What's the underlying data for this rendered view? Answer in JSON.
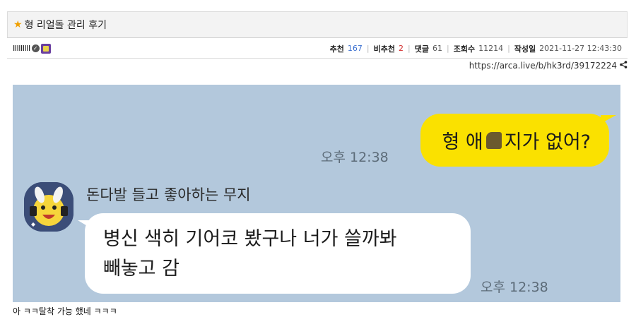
{
  "post": {
    "title_star": "★",
    "title": "형 리얼돌 관리 후기",
    "author": "IIIIIIIII",
    "stats": {
      "recommend_label": "추천",
      "recommend_value": "167",
      "unrecommend_label": "비추천",
      "unrecommend_value": "2",
      "comments_label": "댓글",
      "comments_value": "61",
      "views_label": "조회수",
      "views_value": "11214",
      "date_label": "작성일",
      "date_value": "2021-11-27 12:43:30"
    },
    "url": "https://arca.live/b/hk3rd/39172224"
  },
  "chat": {
    "my_message_part1": "형 애",
    "my_message_part2": "지가 없어?",
    "my_time": "오후 12:38",
    "sender_name": "돈다발 들고 좋아하는 무지",
    "their_message_line1": "병신 색히 기어코 봤구나 너가 쓸까봐",
    "their_message_line2": "빼놓고 감",
    "their_time": "오후 12:38",
    "background_color": "#b3c8dc",
    "my_bubble_color": "#fae100"
  },
  "caption": "아 ㅋㅋ탈착 가능 했네 ㅋㅋㅋ"
}
